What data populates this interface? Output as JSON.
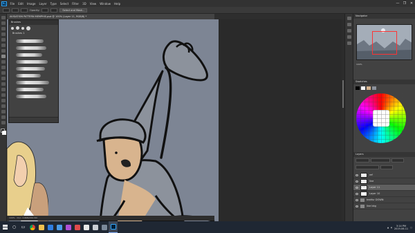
{
  "app": {
    "logo_text": "Ps",
    "menu": [
      "File",
      "Edit",
      "Image",
      "Layer",
      "Type",
      "Select",
      "Filter",
      "3D",
      "View",
      "Window",
      "Help"
    ],
    "window_controls": [
      "—",
      "❐",
      "✕"
    ]
  },
  "options_bar": {
    "opacity_label": "Opacity:",
    "select_mask_label": "Select and Mask..."
  },
  "document_tab": {
    "title": "AVIGATION PATTERN MEMPHIS.psd @ 100% (Layer 11, RGB/8) *"
  },
  "brushes_panel": {
    "title": "Brushes",
    "folder_label": "Brushes 1",
    "stroke_count": 9
  },
  "navigator_panel": {
    "title": "Navigator",
    "zoom": "100%"
  },
  "swatches_panel": {
    "title": "Swatches"
  },
  "layers_panel": {
    "title": "Layers",
    "layers": [
      {
        "name": "ref",
        "kind": "layer",
        "thumb": "trans",
        "selected": false
      },
      {
        "name": "line",
        "kind": "layer",
        "thumb": "trans",
        "selected": false
      },
      {
        "name": "Layer 11",
        "kind": "layer",
        "thumb": "trans",
        "selected": true
      },
      {
        "name": "Layer 10",
        "kind": "layer",
        "thumb": "white",
        "selected": false
      },
      {
        "name": "textfur DOWN",
        "kind": "folder",
        "thumb": "",
        "selected": false
      },
      {
        "name": "line bkg",
        "kind": "folder",
        "thumb": "",
        "selected": false
      }
    ]
  },
  "status_bar": {
    "zoom": "100%",
    "doc_info": "Doc: 3.86M/150.5M"
  },
  "taskbar": {
    "apps": [
      "chrome",
      "file-explorer",
      "store",
      "mail",
      "photos",
      "media",
      "app-a",
      "app-b",
      "app-c",
      "photoshop"
    ],
    "active_app": "photoshop",
    "time": "3:14 PM",
    "date": "2019-06-11"
  },
  "colors": {
    "canvas_bg": "#7d8594",
    "ps_dark": "#2b2b2b",
    "panel": "#424242",
    "taskbar": "#1f2733",
    "skin": "#d8b48e",
    "shirt": "#8c929c",
    "outline": "#111111"
  }
}
